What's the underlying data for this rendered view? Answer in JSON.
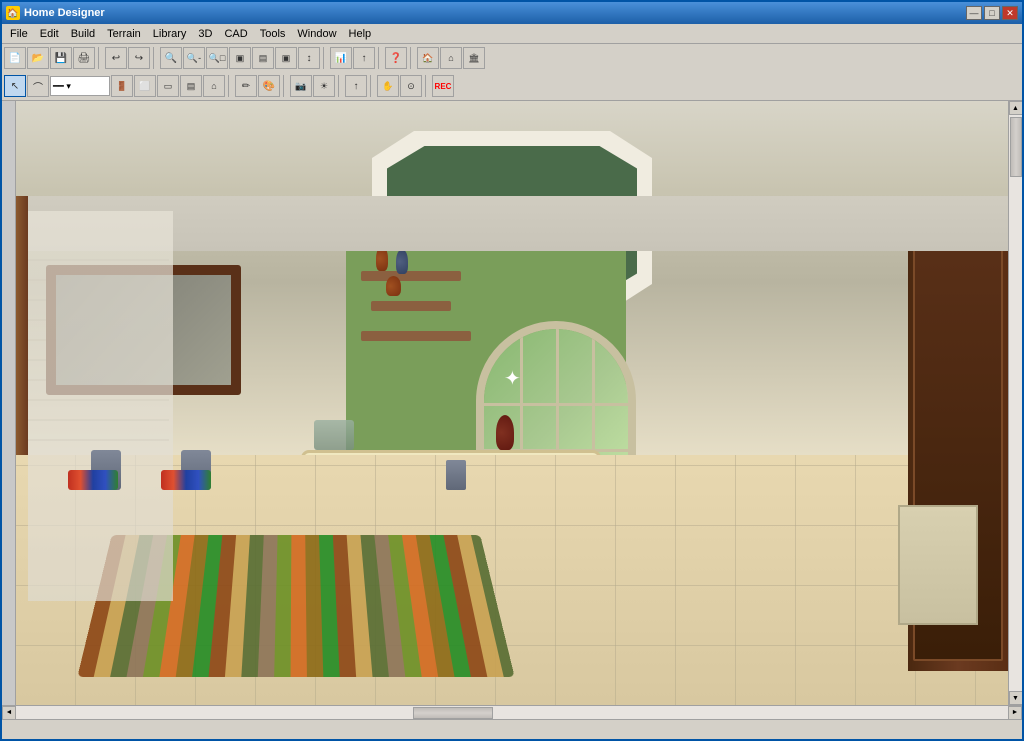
{
  "window": {
    "title": "Home Designer",
    "icon": "🏠"
  },
  "title_buttons": {
    "minimize": "—",
    "maximize": "□",
    "close": "✕"
  },
  "menu": {
    "items": [
      "File",
      "Edit",
      "Build",
      "Terrain",
      "Library",
      "3D",
      "CAD",
      "Tools",
      "Window",
      "Help"
    ]
  },
  "toolbar1": {
    "buttons": [
      "📂",
      "💾",
      "🖨",
      "↩",
      "↪",
      "🔍",
      "🔍",
      "🔍",
      "□",
      "□",
      "□",
      "□",
      "□",
      "□",
      "↕",
      "📊",
      "❓",
      "🏠",
      "🏠",
      "🏠"
    ]
  },
  "toolbar2": {
    "buttons": [
      "↖",
      "⌒",
      "━",
      "□",
      "□",
      "□",
      "□",
      "□",
      "✏",
      "🎨",
      "⚙",
      "↑",
      "⚙",
      "REC"
    ]
  },
  "status": {
    "text": ""
  }
}
